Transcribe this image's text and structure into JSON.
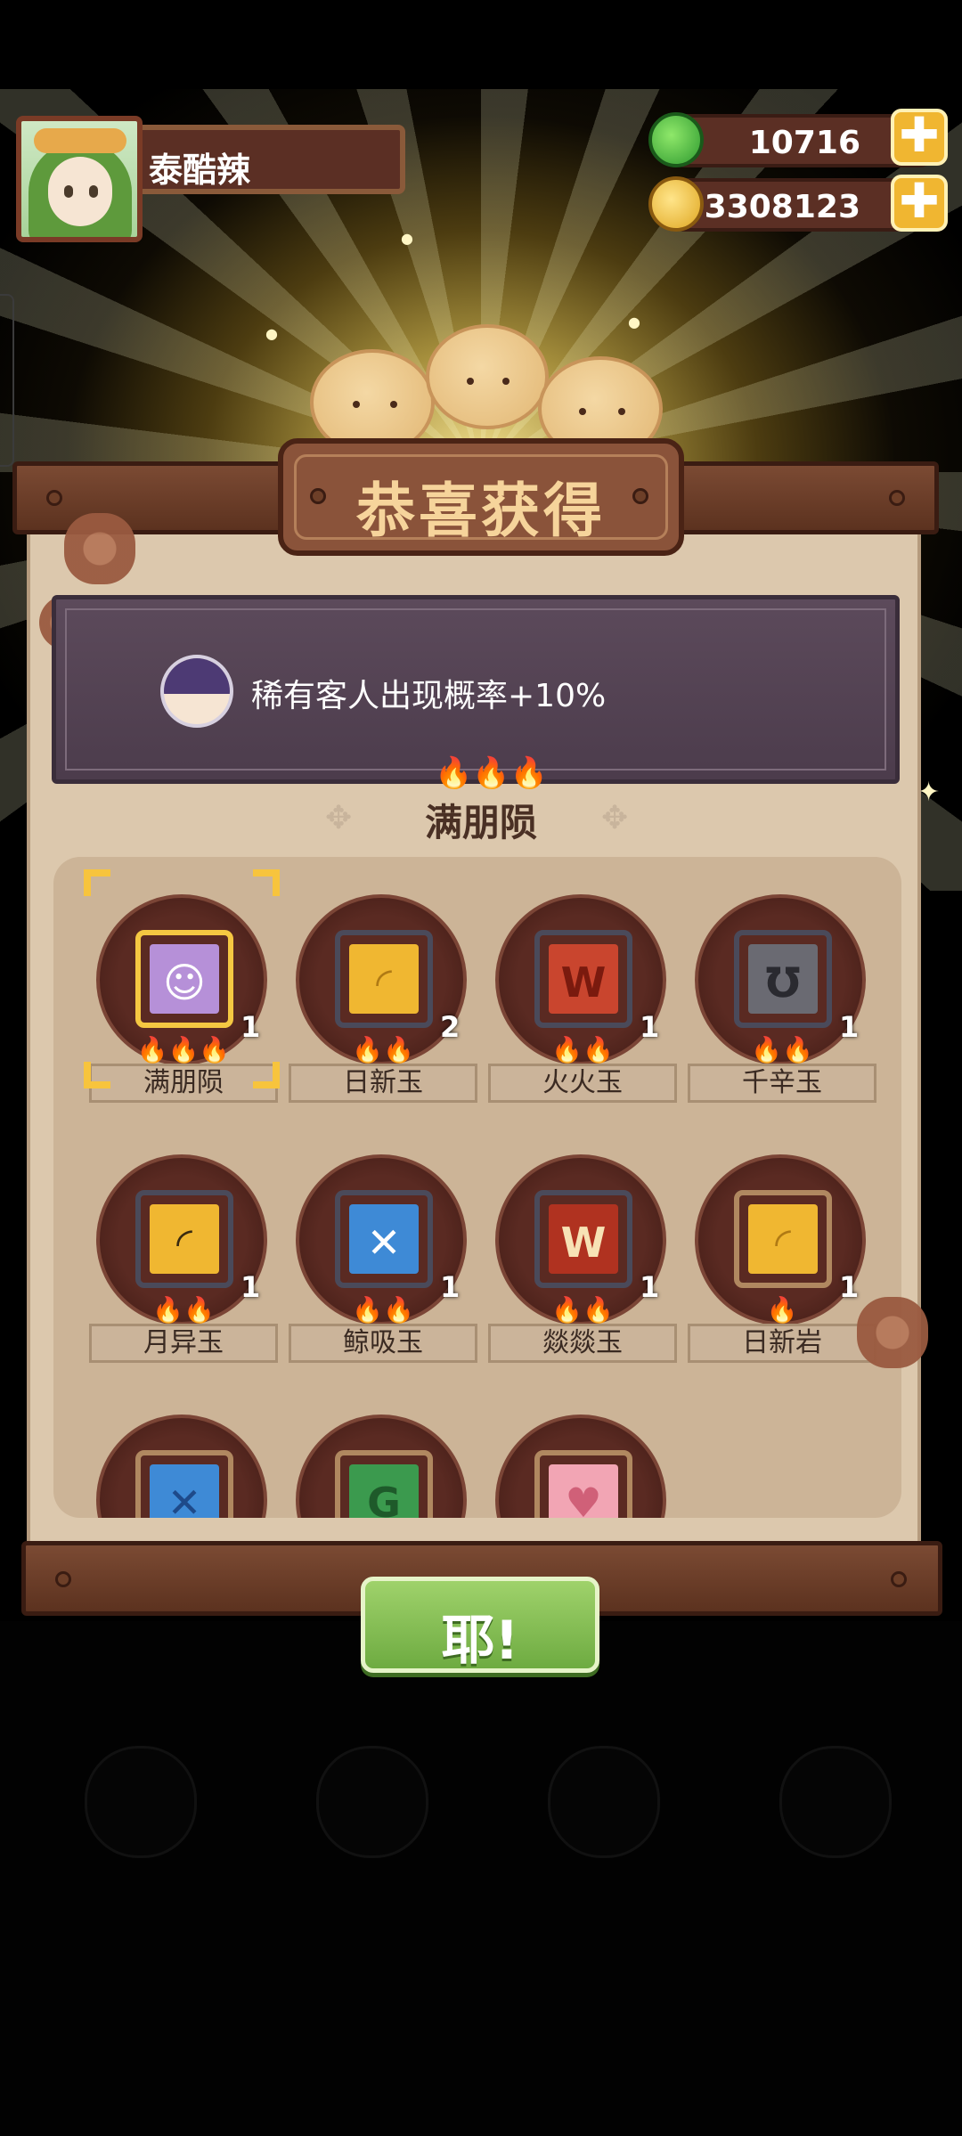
{
  "player": {
    "name": "泰酷辣"
  },
  "currency": {
    "gems": "10716",
    "coins": "3308123",
    "plus_label": "✚"
  },
  "reward": {
    "title": "恭喜获得",
    "buff_text": "稀有客人出现概率+10%",
    "recipe_flames": "🔥🔥🔥",
    "recipe_name": "满朋陨",
    "confirm_label": "耶!"
  },
  "items": [
    {
      "name": "满朋陨",
      "qty": "1",
      "flames": "🔥🔥🔥",
      "color": "#b690d8",
      "border": "#f5c842",
      "glyph": "☺",
      "glyph_color": "#ffffff"
    },
    {
      "name": "日新玉",
      "qty": "2",
      "flames": "🔥🔥",
      "color": "#f0b731",
      "border": "#4a4a5a",
      "glyph": "◜",
      "glyph_color": "#b07a14"
    },
    {
      "name": "火火玉",
      "qty": "1",
      "flames": "🔥🔥",
      "color": "#c9452e",
      "border": "#4a4a5a",
      "glyph": "W",
      "glyph_color": "#7a1a0e"
    },
    {
      "name": "千辛玉",
      "qty": "1",
      "flames": "🔥🔥",
      "color": "#6a6a72",
      "border": "#4a4a5a",
      "glyph": "℧",
      "glyph_color": "#2a2a30"
    },
    {
      "name": "月异玉",
      "qty": "1",
      "flames": "🔥🔥",
      "color": "#f0b731",
      "border": "#4a4a5a",
      "glyph": "◜",
      "glyph_color": "#3a2a10"
    },
    {
      "name": "鲸吸玉",
      "qty": "1",
      "flames": "🔥🔥",
      "color": "#3e8ad6",
      "border": "#4a4a5a",
      "glyph": "✕",
      "glyph_color": "#ffffff"
    },
    {
      "name": "燚燚玉",
      "qty": "1",
      "flames": "🔥🔥",
      "color": "#b03220",
      "border": "#4a4a5a",
      "glyph": "W",
      "glyph_color": "#f7e2b5"
    },
    {
      "name": "日新岩",
      "qty": "1",
      "flames": "🔥",
      "color": "#f0b731",
      "border": "#b08860",
      "glyph": "◜",
      "glyph_color": "#b07a14"
    },
    {
      "name": "",
      "qty": "",
      "flames": "",
      "color": "#3e8ad6",
      "border": "#b08860",
      "glyph": "✕",
      "glyph_color": "#1e4a8a"
    },
    {
      "name": "",
      "qty": "",
      "flames": "",
      "color": "#3b9a4e",
      "border": "#b08860",
      "glyph": "G",
      "glyph_color": "#1e5a2a"
    },
    {
      "name": "",
      "qty": "",
      "flames": "",
      "color": "#f2a5b4",
      "border": "#b08860",
      "glyph": "♥",
      "glyph_color": "#d06078"
    }
  ]
}
